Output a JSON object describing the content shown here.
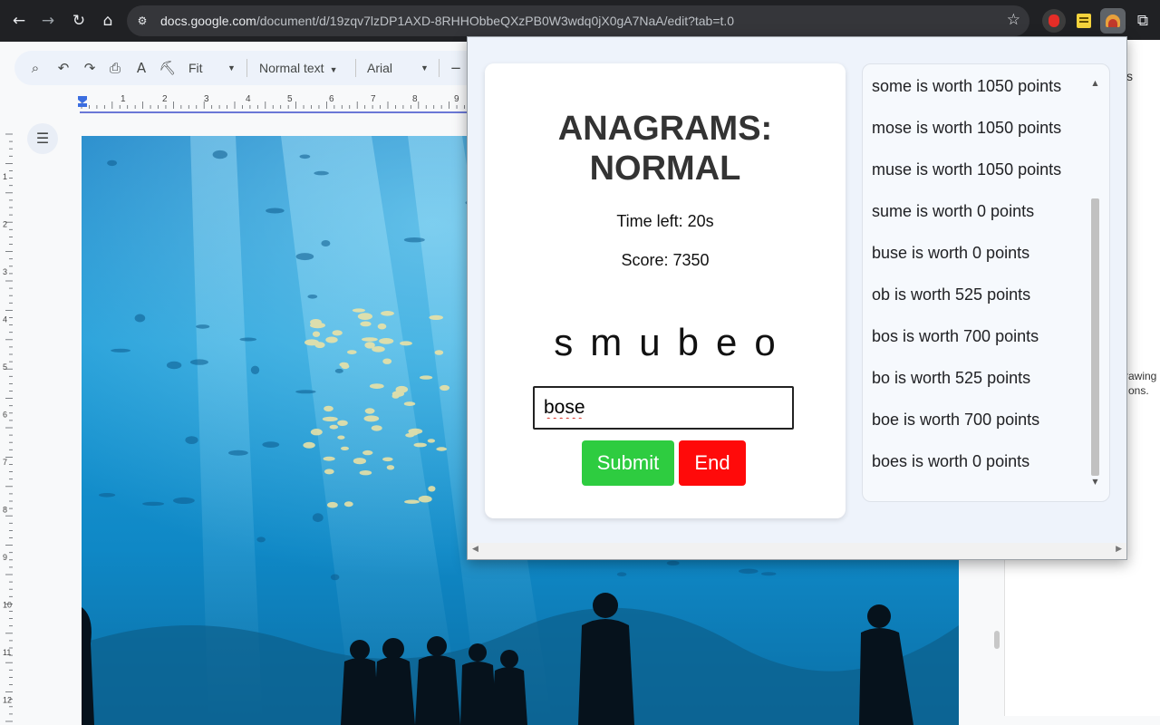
{
  "browser": {
    "url_host": "docs.google.com",
    "url_path": "/document/d/19zqv7lzDP1AXD-8RHHObbeQXzPB0W3wdq0jX0gA7NaA/edit?tab=t.0"
  },
  "docs_toolbar": {
    "zoom": "Fit",
    "style": "Normal text",
    "font": "Arial"
  },
  "right_panel": {
    "text_line1": "rawing",
    "text_line2": "ons.",
    "text_top": "s"
  },
  "game": {
    "title": "ANAGRAMS: NORMAL",
    "time_left": "Time left: 20s",
    "score": "Score: 7350",
    "letters": "smubeo",
    "input_value": "bose",
    "submit_label": "Submit",
    "end_label": "End",
    "history": [
      "some is worth 1050 points",
      "mose is worth 1050 points",
      "muse is worth 1050 points",
      "sume is worth 0 points",
      "buse is worth 0 points",
      "ob is worth 525 points",
      "bos is worth 700 points",
      "bo is worth 525 points",
      "boe is worth 700 points",
      "boes is worth 0 points"
    ]
  }
}
